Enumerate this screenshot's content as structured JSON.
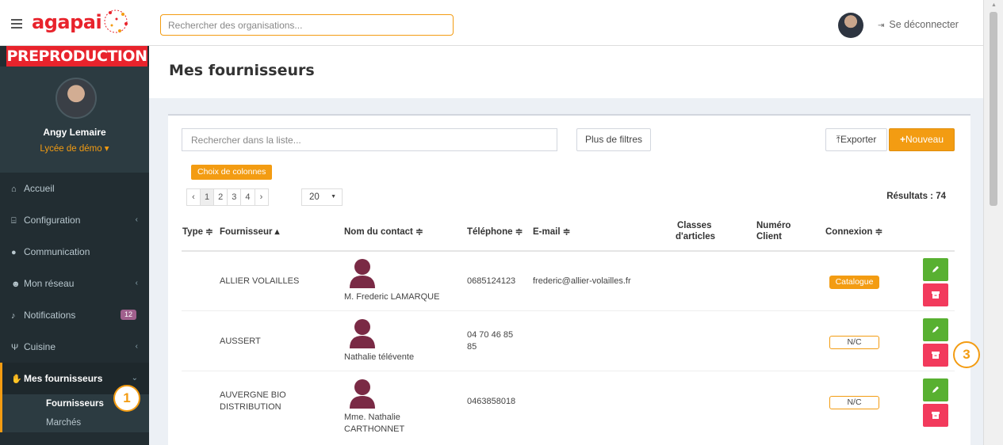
{
  "app": {
    "logo_text": "agapai",
    "environment_label": "PREPRODUCTION"
  },
  "topbar": {
    "search_placeholder": "Rechercher des organisations...",
    "logout_label": "Se déconnecter"
  },
  "user": {
    "name": "Angy Lemaire",
    "school": "Lycée de démo ▾"
  },
  "sidebar": {
    "items": [
      {
        "label": "Accueil",
        "icon": "home-icon"
      },
      {
        "label": "Configuration",
        "icon": "bank-icon"
      },
      {
        "label": "Communication",
        "icon": "chat-icon"
      },
      {
        "label": "Mon réseau",
        "icon": "users-icon"
      },
      {
        "label": "Notifications",
        "icon": "bell-icon",
        "badge": "12"
      },
      {
        "label": "Cuisine",
        "icon": "cutlery-icon"
      },
      {
        "label": "Mes fournisseurs",
        "icon": "handshake-icon"
      }
    ],
    "subitems": [
      {
        "label": "Fournisseurs"
      },
      {
        "label": "Marchés"
      }
    ]
  },
  "page": {
    "title": "Mes fournisseurs"
  },
  "toolbar": {
    "search_placeholder": "Rechercher dans la liste...",
    "filters_label": "Plus de filtres",
    "export_label": "Exporter",
    "new_label": "Nouveau",
    "columns_label": "Choix de colonnes"
  },
  "pagination": {
    "prev": "‹",
    "pages": [
      "1",
      "2",
      "3",
      "4"
    ],
    "next": "›",
    "per_page": "20",
    "results": "Résultats : 74"
  },
  "table": {
    "headers": {
      "type": "Type ≑",
      "supplier": "Fournisseur ▴",
      "contact": "Nom du contact ≑",
      "phone": "Téléphone ≑",
      "email": "E-mail ≑",
      "classes_1": "Classes",
      "classes_2": "d'articles",
      "client_1": "Numéro",
      "client_2": "Client",
      "connection": "Connexion ≑"
    },
    "rows": [
      {
        "supplier_1": "ALLIER VOLAILLES",
        "supplier_2": "",
        "contact_1": "M. Frederic LAMARQUE",
        "contact_2": "",
        "phone_1": "0685124123",
        "phone_2": "",
        "email": "frederic@allier-volailles.fr",
        "connection": "Catalogue"
      },
      {
        "supplier_1": "AUSSERT",
        "supplier_2": "",
        "contact_1": "Nathalie télévente",
        "contact_2": "",
        "phone_1": "04 70 46 85",
        "phone_2": "85",
        "email": "",
        "connection": "N/C"
      },
      {
        "supplier_1": "AUVERGNE BIO",
        "supplier_2": "DISTRIBUTION",
        "contact_1": "Mme. Nathalie",
        "contact_2": "CARTHONNET",
        "phone_1": "0463858018",
        "phone_2": "",
        "email": "",
        "connection": "N/C"
      }
    ]
  },
  "annotations": {
    "marker_1": "1",
    "marker_3": "3"
  },
  "colors": {
    "accent": "#f39c12",
    "brand_red": "#e8232c",
    "edit_green": "#58b031",
    "delete_pink": "#f23a5c",
    "sidebar": "#222d32"
  }
}
